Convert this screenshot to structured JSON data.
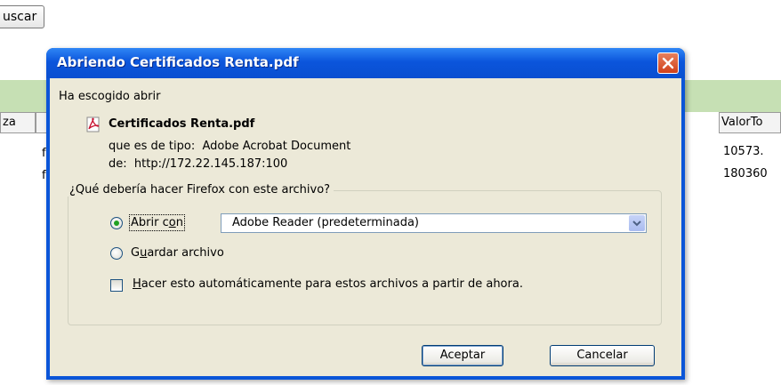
{
  "background": {
    "search_button": "uscar",
    "column_headers": [
      "za",
      "ValorTo"
    ],
    "cells": [
      "f",
      "f",
      "10573.",
      "180360"
    ]
  },
  "dialog": {
    "title": "Abriendo Certificados Renta.pdf",
    "intro": "Ha escogido abrir",
    "file_name": "Certificados Renta.pdf",
    "type_label": "que es de tipo:",
    "type_value": "Adobe Acrobat Document",
    "from_label": "de:",
    "from_value": "http://172.22.145.187:100",
    "question": "¿Qué debería hacer Firefox con este archivo?",
    "open_with": {
      "pre": "Abrir c",
      "u": "o",
      "post": "n",
      "checked": true
    },
    "open_with_app": "Adobe Reader  (predeterminada)",
    "save_file": {
      "pre": "G",
      "u": "u",
      "post": "ardar archivo",
      "checked": false
    },
    "auto": {
      "pre": "",
      "u": "H",
      "post": "acer esto automáticamente para estos archivos a partir de ahora.",
      "checked": false
    },
    "accept_label": "Aceptar",
    "cancel_label": "Cancelar"
  },
  "colors": {
    "title_bar": "#0a55d8",
    "dialog_body": "#ece9d8",
    "header_band": "#c6e0b4",
    "radio_dot": "#21a121"
  },
  "icons": [
    "pdf-file-icon",
    "close-icon",
    "chevron-down-icon"
  ]
}
